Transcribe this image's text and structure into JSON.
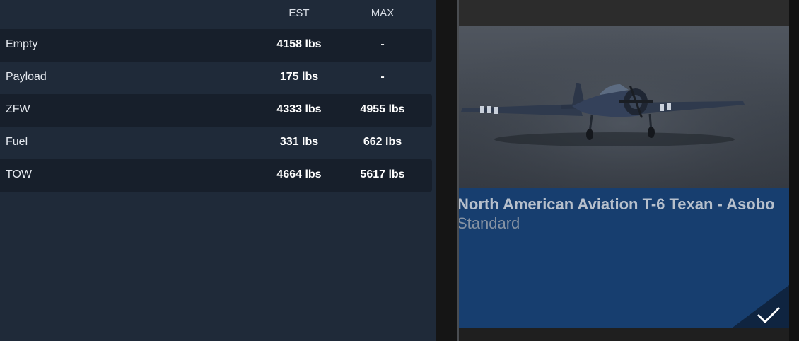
{
  "weights": {
    "headers": {
      "est": "EST",
      "max": "MAX"
    },
    "rows": [
      {
        "label": "Empty",
        "est": "4158 lbs",
        "max": "-"
      },
      {
        "label": "Payload",
        "est": "175 lbs",
        "max": "-"
      },
      {
        "label": "ZFW",
        "est": "4333 lbs",
        "max": "4955 lbs"
      },
      {
        "label": "Fuel",
        "est": "331 lbs",
        "max": "662 lbs"
      },
      {
        "label": "TOW",
        "est": "4664 lbs",
        "max": "5617 lbs"
      }
    ]
  },
  "aircraft": {
    "title": "North American Aviation T-6 Texan - Asobo",
    "livery": "Standard",
    "selected": true,
    "selected_icon": "checkmark-icon"
  },
  "colors": {
    "panel_bg": "#1f2a39",
    "row_alt_bg": "#171f2b",
    "card_info_bg": "#173e6f"
  }
}
